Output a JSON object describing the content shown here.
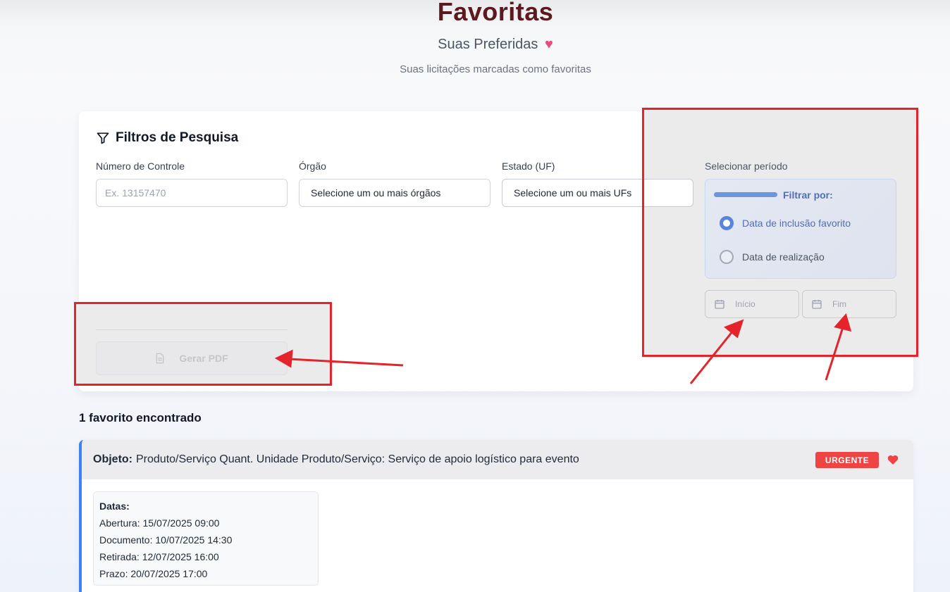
{
  "header": {
    "title": "Favoritas",
    "subtitle": "Suas Preferidas",
    "subtitle_emoji": "♥",
    "description": "Suas licitações marcadas como favoritas"
  },
  "filters": {
    "title": "Filtros de Pesquisa",
    "numero_controle": {
      "label": "Número de Controle",
      "placeholder": "Ex. 13157470"
    },
    "orgao": {
      "label": "Órgão",
      "value": "Selecione um ou mais órgãos"
    },
    "estado": {
      "label": "Estado (UF)",
      "value": "Selecione um ou mais UFs"
    },
    "periodo": {
      "label": "Selecionar período",
      "filter_by": "Filtrar por:",
      "options": [
        "Data de inclusão favorito",
        "Data de realização"
      ],
      "selected_index": 0,
      "start_placeholder": "Início",
      "end_placeholder": "Fim"
    },
    "pdf_button": "Gerar PDF"
  },
  "results": {
    "count_text": "1 favorito encontrado",
    "items": [
      {
        "objeto_label": "Objeto:",
        "objeto": "Produto/Serviço Quant. Unidade Produto/Serviço: Serviço de apoio logístico para evento",
        "badge": "URGENTE",
        "dates_title": "Datas:",
        "dates": [
          "Abertura: 15/07/2025 09:00",
          "Documento: 10/07/2025 14:30",
          "Retirada: 12/07/2025 16:00",
          "Prazo: 20/07/2025 17:00"
        ]
      }
    ]
  },
  "colors": {
    "title": "#5c1a1f",
    "accent_blue": "#5883e0",
    "urgent": "#ef4444",
    "highlight_border": "#e5232a"
  }
}
